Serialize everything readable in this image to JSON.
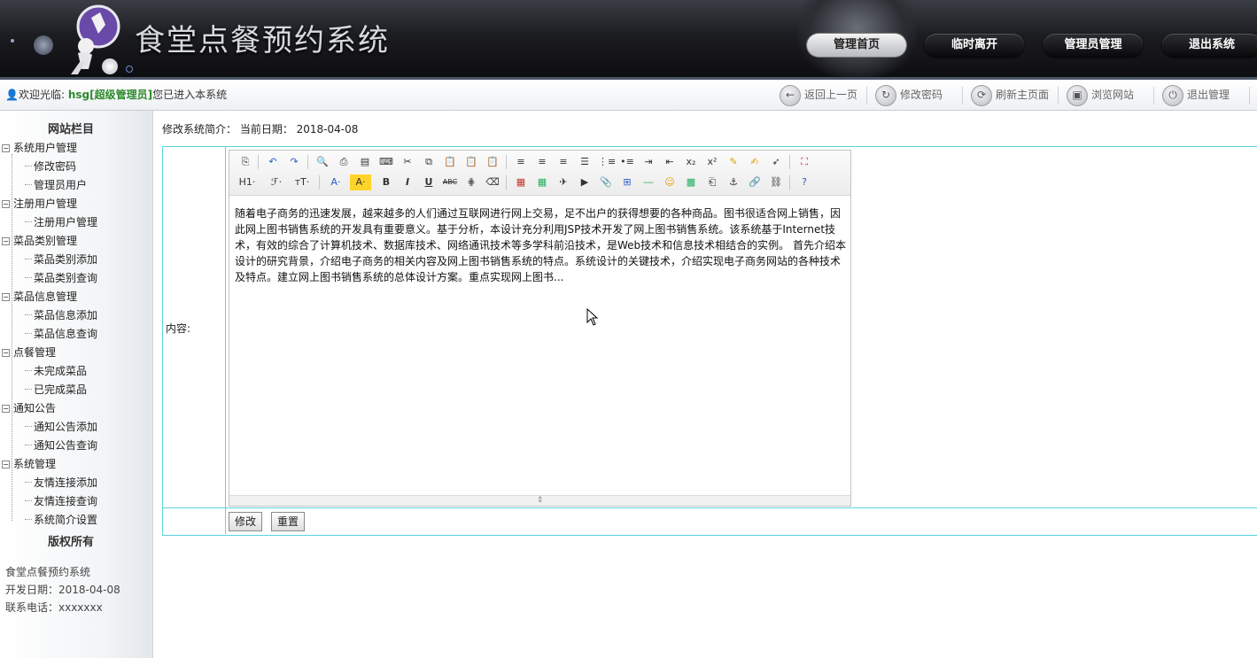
{
  "header": {
    "title": "食堂点餐预约系统",
    "nav": [
      "管理首页",
      "临时离开",
      "管理员管理",
      "退出系统"
    ]
  },
  "welcome": {
    "prefix": "欢迎光临:",
    "user": "hsg[超级管理员]",
    "suffix": "您已进入本系统"
  },
  "toolbar_links": [
    {
      "label": "返回上一页",
      "icon": "back-icon"
    },
    {
      "label": "修改密码",
      "icon": "password-icon"
    },
    {
      "label": "刷新主页面",
      "icon": "refresh-icon"
    },
    {
      "label": "浏览网站",
      "icon": "browse-icon"
    },
    {
      "label": "退出管理",
      "icon": "power-icon"
    }
  ],
  "sidebar": {
    "head": "网站栏目",
    "groups": [
      {
        "label": "系统用户管理",
        "items": [
          "修改密码",
          "管理员用户"
        ]
      },
      {
        "label": "注册用户管理",
        "items": [
          "注册用户管理"
        ]
      },
      {
        "label": "菜品类别管理",
        "items": [
          "菜品类别添加",
          "菜品类别查询"
        ]
      },
      {
        "label": "菜品信息管理",
        "items": [
          "菜品信息添加",
          "菜品信息查询"
        ]
      },
      {
        "label": "点餐管理",
        "items": [
          "未完成菜品",
          "已完成菜品"
        ]
      },
      {
        "label": "通知公告",
        "items": [
          "通知公告添加",
          "通知公告查询"
        ]
      },
      {
        "label": "系统管理",
        "items": [
          "友情连接添加",
          "友情连接查询",
          "系统简介设置"
        ]
      }
    ],
    "copyright": "版权所有",
    "info": [
      "食堂点餐预约系统",
      "开发日期：2018-04-08",
      "联系电话：xxxxxxx"
    ]
  },
  "main": {
    "title": "修改系统简介：  当前日期：  2018-04-08",
    "content_label": "内容:",
    "editor_text": "随着电子商务的迅速发展，越来越多的人们通过互联网进行网上交易，足不出户的获得想要的各种商品。图书很适合网上销售，因此网上图书销售系统的开发具有重要意义。基于分析，本设计充分利用JSP技术开发了网上图书销售系统。该系统基于Internet技术，有效的综合了计算机技术、数据库技术、网络通讯技术等多学科前沿技术，是Web技术和信息技术相结合的实例。 首先介绍本设计的研究背景，介绍电子商务的相关内容及网上图书销售系统的特点。系统设计的关键技术，介绍实现电子商务网站的各种技术及特点。建立网上图书销售系统的总体设计方案。重点实现网上图书...",
    "submit_label": "修改",
    "reset_label": "重置"
  },
  "editor_toolbar": {
    "row2_text": [
      "H1·",
      "ℱ·",
      "ᴛT·",
      "A·",
      "A·",
      "B",
      "I",
      "U",
      "ABC"
    ]
  }
}
